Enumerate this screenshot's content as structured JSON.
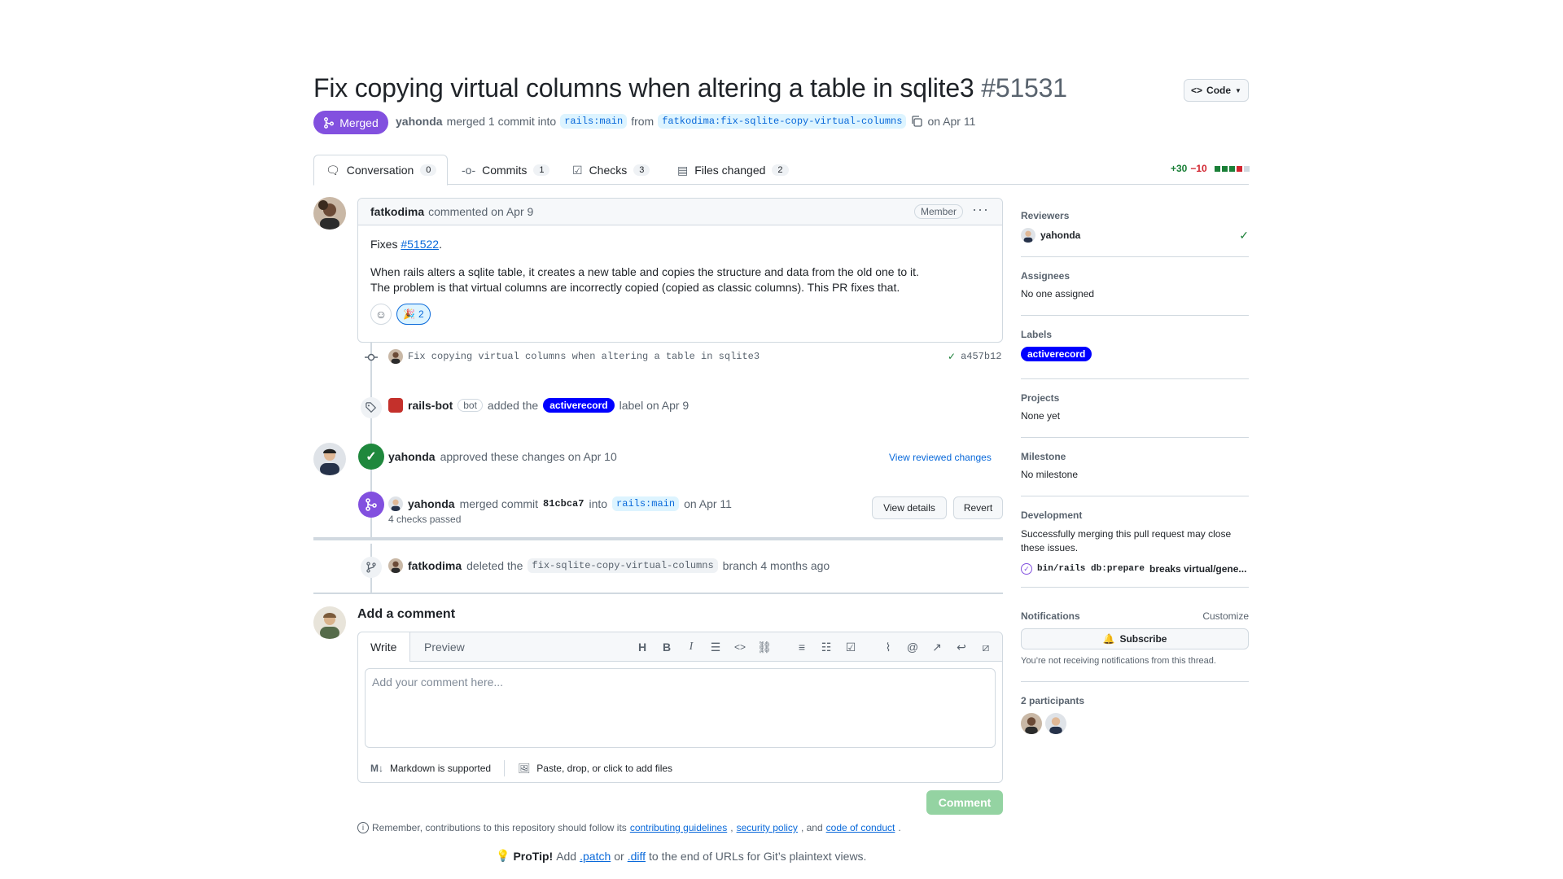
{
  "header": {
    "title": "Fix copying virtual columns when altering a table in sqlite3",
    "number": "#51531",
    "code_button": "Code",
    "status": "Merged",
    "author": "yahonda",
    "merge_text": "merged 1 commit into",
    "base_branch": "rails:main",
    "from_text": "from",
    "head_branch": "fatkodima:fix-sqlite-copy-virtual-columns",
    "date": "on Apr 11"
  },
  "tabs": [
    {
      "label": "Conversation",
      "count": "0"
    },
    {
      "label": "Commits",
      "count": "1"
    },
    {
      "label": "Checks",
      "count": "3"
    },
    {
      "label": "Files changed",
      "count": "2"
    }
  ],
  "diffstat": {
    "additions": "+30",
    "deletions": "−10"
  },
  "comment": {
    "author": "fatkodima",
    "action": "commented on Apr 9",
    "badge": "Member",
    "fixes_prefix": "Fixes",
    "fixes_link": "#51522",
    "fixes_suffix": ".",
    "line1": "When rails alters a sqlite table, it creates a new table and copies the structure and data from the old one to it.",
    "line2": "The problem is that virtual columns are incorrectly copied (copied as classic columns). This PR fixes that.",
    "reaction_emoji": "🎉",
    "reaction_count": "2"
  },
  "timeline": {
    "commit_message": "Fix copying virtual columns when altering a table in sqlite3",
    "commit_sha": "a457b12",
    "label_event": {
      "actor": "rails-bot",
      "bot": "bot",
      "action": "added the",
      "label": "activerecord",
      "suffix": "label on Apr 9"
    },
    "review_event": {
      "actor": "yahonda",
      "action": "approved these changes on Apr 10",
      "link": "View reviewed changes"
    },
    "merge_event": {
      "actor": "yahonda",
      "action": "merged commit",
      "sha": "81cbca7",
      "into": "into",
      "branch": "rails:main",
      "date": "on Apr 11",
      "checks": "4 checks passed",
      "view_details": "View details",
      "revert": "Revert"
    },
    "delete_event": {
      "actor": "fatkodima",
      "action": "deleted the",
      "branch": "fix-sqlite-copy-virtual-columns",
      "suffix": "branch 4 months ago"
    }
  },
  "add_comment": {
    "title": "Add a comment",
    "write_tab": "Write",
    "preview_tab": "Preview",
    "placeholder": "Add your comment here...",
    "markdown": "Markdown is supported",
    "attach": "Paste, drop, or click to add files",
    "submit": "Comment",
    "remember_prefix": "Remember, contributions to this repository should follow its",
    "link1": "contributing guidelines",
    "comma1": ",",
    "link2": "security policy",
    "and": ", and",
    "link3": "code of conduct",
    "period": ".",
    "protip_label": "ProTip!",
    "protip_add": "Add",
    "protip_patch": ".patch",
    "protip_or": "or",
    "protip_diff": ".diff",
    "protip_tail": "to the end of URLs for Git’s plaintext views."
  },
  "sidebar": {
    "reviewers_h": "Reviewers",
    "reviewer": "yahonda",
    "assignees_h": "Assignees",
    "assignees": "No one assigned",
    "labels_h": "Labels",
    "label": "activerecord",
    "projects_h": "Projects",
    "projects": "None yet",
    "milestone_h": "Milestone",
    "milestone": "No milestone",
    "development_h": "Development",
    "development_text": "Successfully merging this pull request may close these issues.",
    "dev_issue_code": "bin/rails db:prepare",
    "dev_issue_text": "breaks virtual/gene...",
    "notifications_h": "Notifications",
    "customize": "Customize",
    "subscribe": "Subscribe",
    "not_receiving": "You’re not receiving notifications from this thread.",
    "participants_h": "2 participants"
  },
  "colors": {
    "merged": "#8250df",
    "label": "#0000ff",
    "success": "#1a7f37",
    "link": "#0969da"
  }
}
